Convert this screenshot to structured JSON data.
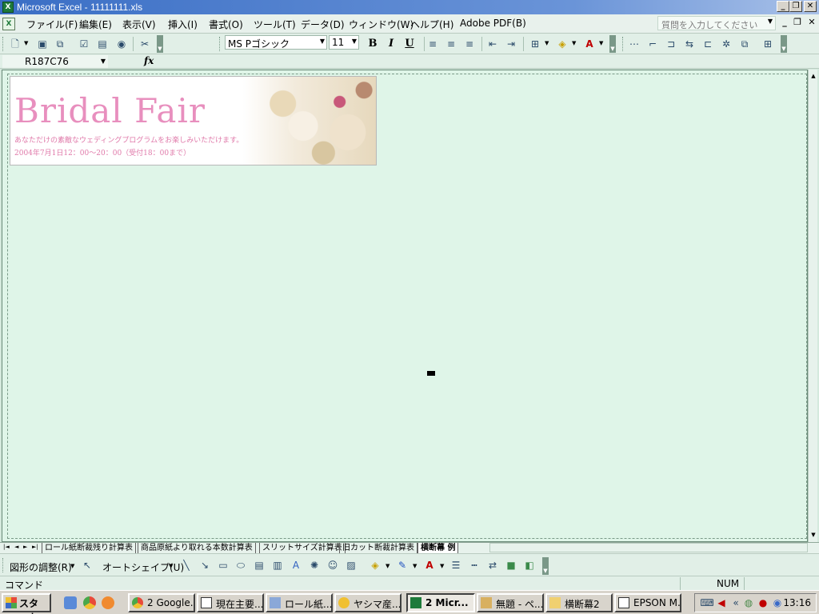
{
  "window": {
    "title": "Microsoft Excel - 11111111.xls",
    "min": "_",
    "restore": "❐",
    "close": "✕"
  },
  "menu": {
    "items": [
      "ファイル(F)",
      "編集(E)",
      "表示(V)",
      "挿入(I)",
      "書式(O)",
      "ツール(T)",
      "データ(D)",
      "ウィンドウ(W)",
      "ヘルプ(H)",
      "Adobe PDF(B)"
    ],
    "help_placeholder": "質問を入力してください"
  },
  "format": {
    "font_name": "MS Pゴシック",
    "font_size": "11",
    "bold": "B",
    "italic": "I",
    "underline": "U"
  },
  "formula": {
    "namebox": "R187C76",
    "fx": "fx"
  },
  "banner": {
    "headline": "Bridal Fair",
    "sub1": "あなただけの素敵なウェディングプログラムをお楽しみいただけます。",
    "sub2": "2004年7月1日12：00～20：00（受付18：00まで）"
  },
  "sheet_tabs": [
    "ロール紙断裁残り計算表",
    "商品原紙より取れる本数計算表",
    "スリットサイズ計算表",
    "旧カット断裁計算表",
    "横断幕 例"
  ],
  "active_tab_index": 4,
  "drawing": {
    "adjust": "図形の調整(R)",
    "autoshape": "オートシェイプ(U)"
  },
  "status": {
    "mode": "コマンド",
    "num": "NUM"
  },
  "taskbar": {
    "start": "スタート",
    "tasks": [
      "2 Google...",
      "現在主要...",
      "ロール紙...",
      "ヤシマ産...",
      "2 Micr...",
      "無題 - ペ...",
      "横断幕2",
      "EPSON M..."
    ],
    "active_index": 4,
    "clock": "13:16"
  }
}
